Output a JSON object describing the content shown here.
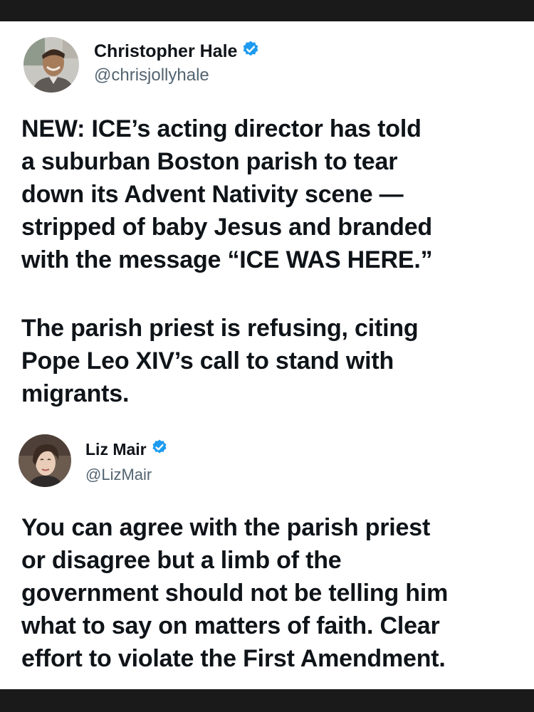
{
  "post1": {
    "author_name": "Christopher Hale",
    "handle": "@chrisjollyhale",
    "paragraph1_lines": [
      "NEW: ICE’s acting director has told",
      "a suburban Boston parish to tear",
      "down its Advent Nativity scene —",
      "stripped of baby Jesus and branded",
      "with the message “ICE WAS HERE.”"
    ],
    "paragraph2_lines": [
      "The parish priest is refusing, citing",
      "Pope Leo XIV’s call to stand with",
      "migrants."
    ]
  },
  "post2": {
    "author_name": "Liz Mair",
    "handle": "@LizMair",
    "paragraph1_lines": [
      "You can agree with the parish priest",
      "or disagree but a limb of the",
      "government should not be telling him",
      "what to say on matters of faith. Clear",
      "effort to violate the First Amendment."
    ]
  },
  "icons": {
    "verified": "verified-badge-icon"
  },
  "colors": {
    "verified_blue": "#1d9bf0",
    "text": "#0f1419",
    "handle": "#536471",
    "frame": "#1a1a1a"
  }
}
